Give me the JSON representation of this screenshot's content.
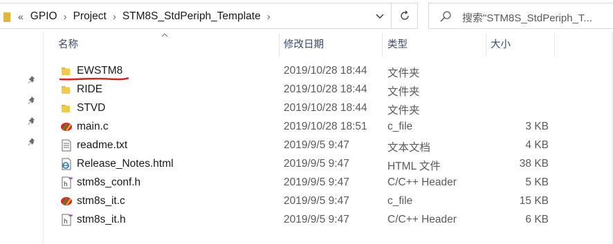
{
  "address": {
    "overflow_chevron": "«",
    "crumbs": [
      "GPIO",
      "Project",
      "STM8S_StdPeriph_Template"
    ],
    "separator": "›"
  },
  "search": {
    "placeholder": "搜索\"STM8S_StdPeriph_T..."
  },
  "columns": {
    "name": "名称",
    "date": "修改日期",
    "type": "类型",
    "size": "大小"
  },
  "files": [
    {
      "name": "EWSTM8",
      "date": "2019/10/28 18:44",
      "type": "文件夹",
      "size": "",
      "icon": "folder-icon"
    },
    {
      "name": "RIDE",
      "date": "2019/10/28 18:44",
      "type": "文件夹",
      "size": "",
      "icon": "folder-icon"
    },
    {
      "name": "STVD",
      "date": "2019/10/28 18:44",
      "type": "文件夹",
      "size": "",
      "icon": "folder-icon"
    },
    {
      "name": "main.c",
      "date": "2019/10/28 18:51",
      "type": "c_file",
      "size": "3 KB",
      "icon": "c-file-icon"
    },
    {
      "name": "readme.txt",
      "date": "2019/9/5 9:47",
      "type": "文本文档",
      "size": "4 KB",
      "icon": "text-file-icon"
    },
    {
      "name": "Release_Notes.html",
      "date": "2019/9/5 9:47",
      "type": "HTML 文件",
      "size": "38 KB",
      "icon": "html-file-icon"
    },
    {
      "name": "stm8s_conf.h",
      "date": "2019/9/5 9:47",
      "type": "C/C++ Header",
      "size": "5 KB",
      "icon": "header-file-icon"
    },
    {
      "name": "stm8s_it.c",
      "date": "2019/9/5 9:47",
      "type": "c_file",
      "size": "15 KB",
      "icon": "c-file-icon"
    },
    {
      "name": "stm8s_it.h",
      "date": "2019/9/5 9:47",
      "type": "C/C++ Header",
      "size": "6 KB",
      "icon": "header-file-icon"
    }
  ],
  "colors": {
    "folder": "#e8b637",
    "header_text": "#3c4a6b",
    "annotation": "#e02020"
  }
}
